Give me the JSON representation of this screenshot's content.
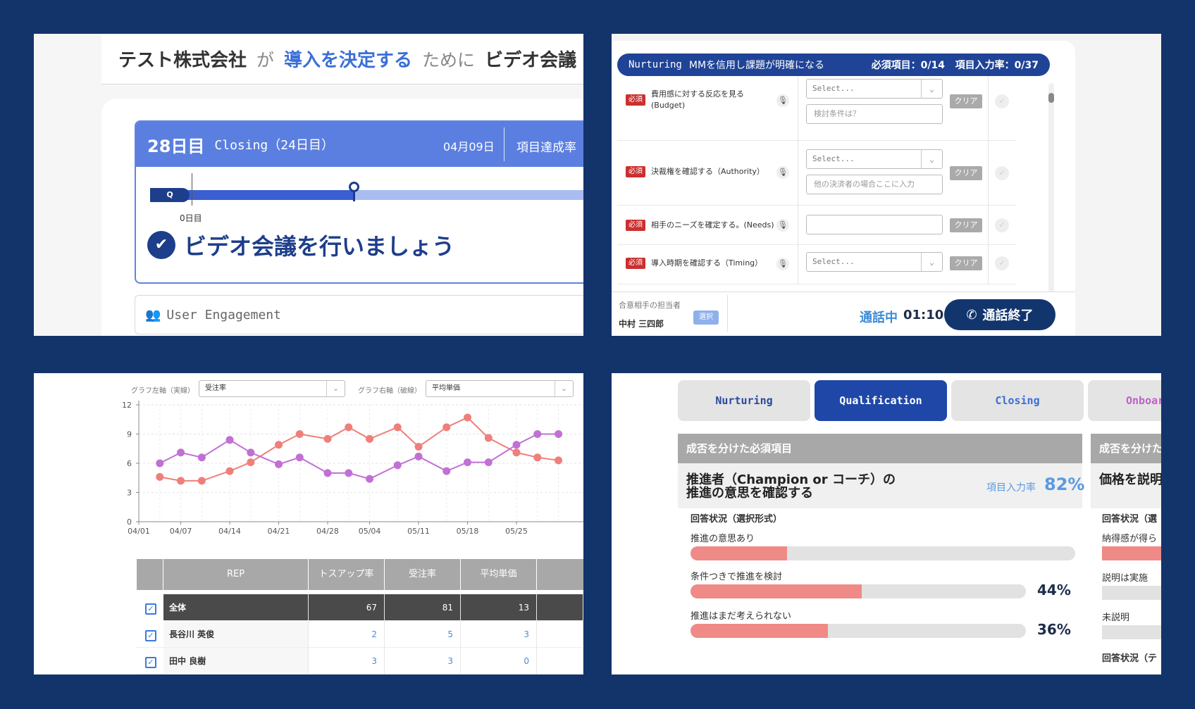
{
  "panel1": {
    "sentence": {
      "company": "テスト株式会社",
      "ga": "が",
      "goal": "導入を決定する",
      "tame": "ために",
      "action": "ビデオ会議"
    },
    "progress": {
      "day": "28日目",
      "phase": "Closing（24日目）",
      "date": "04月09日",
      "rate_label": "項目達成率",
      "stage_marker": "Q",
      "zero_label": "0日目",
      "progress_fraction": 0.44
    },
    "message": "ビデオ会議を行いましょう",
    "engagement": "User Engagement",
    "icons": {
      "message": "check-person-icon",
      "engagement": "users-icon"
    }
  },
  "panel2": {
    "header": {
      "phase": "Nurturing",
      "title": "MMを信用し課題が明確になる",
      "required": "必須項目：0/14",
      "input_rate": "項目入力率：0/37"
    },
    "rows": [
      {
        "badge": "必須",
        "label": "費用感に対する反応を見る\n(Budget)",
        "select": "Select...",
        "input": "検討条件は？",
        "clear": "クリア"
      },
      {
        "badge": "必須",
        "label": "決裁権を確認する（Authority）",
        "select": "Select...",
        "input": "他の決済者の場合ここに入力",
        "clear": "クリア"
      },
      {
        "badge": "必須",
        "label": "相手のニーズを確定する。(Needs)",
        "select": "",
        "input": "",
        "clear": "クリア"
      },
      {
        "badge": "必須",
        "label": "導入時期を確認する（Timing）",
        "select": "Select...",
        "input": "",
        "clear": "クリア"
      }
    ],
    "footer": {
      "assignee_label": "合意相手の担当者",
      "assignee": "中村 三四郎",
      "select_button": "選択",
      "status": "通話中",
      "timer": "01:10",
      "end_button": "通話終了"
    }
  },
  "panel3": {
    "controls": {
      "left_label": "グラフ左軸（実線）",
      "left_value": "受注率",
      "right_label": "グラフ右軸（破線）",
      "right_value": "平均単価"
    },
    "chart_data": {
      "type": "line",
      "x": [
        "04/04",
        "04/07",
        "04/10",
        "04/14",
        "04/17",
        "04/21",
        "04/24",
        "04/28",
        "05/01",
        "05/04",
        "05/08",
        "05/11",
        "05/15",
        "05/18",
        "05/21",
        "05/25",
        "05/28",
        "05/31"
      ],
      "xticks": [
        "04/01",
        "04/07",
        "04/14",
        "04/21",
        "04/28",
        "05/04",
        "05/11",
        "05/18",
        "05/25"
      ],
      "ylim": [
        0,
        12
      ],
      "yticks": [
        0,
        3,
        6,
        9,
        12
      ],
      "series": [
        {
          "color": "#ef7f7a",
          "values": [
            4.6,
            4.2,
            4.2,
            5.2,
            6.1,
            7.9,
            9.0,
            8.5,
            9.7,
            8.5,
            9.7,
            7.7,
            9.7,
            10.7,
            8.6,
            7.1,
            6.6,
            6.3
          ]
        },
        {
          "color": "#c170d4",
          "values": [
            6.0,
            7.1,
            6.6,
            8.4,
            7.1,
            5.9,
            6.6,
            5.0,
            5.0,
            4.4,
            5.8,
            6.7,
            5.2,
            6.1,
            6.1,
            7.9,
            9.0,
            9.0
          ]
        }
      ],
      "grid": true
    },
    "table": {
      "headers": [
        "REP",
        "トスアップ率",
        "受注率",
        "平均単価"
      ],
      "rows": [
        {
          "name": "全体",
          "v1": "67",
          "v2": "81",
          "v3": "13"
        },
        {
          "name": "長谷川 英俊",
          "v1": "2",
          "v2": "5",
          "v3": "3"
        },
        {
          "name": "田中 良樹",
          "v1": "3",
          "v2": "3",
          "v3": "0"
        }
      ]
    }
  },
  "panel4": {
    "tabs": [
      {
        "label": "Nurturing"
      },
      {
        "label": "Qualification"
      },
      {
        "label": "Closing"
      },
      {
        "label": "Onboar"
      }
    ],
    "section": "成否を分けた必須項目",
    "section2": "成否を分けた",
    "question": "推進者（Champion or コーチ）の\n推進の意思を確認する",
    "question2": "価格を説明",
    "rate_label": "項目入力率",
    "rate": "82%",
    "answers_label": "回答状況（選択形式）",
    "answers_label2": "回答状況（選",
    "options": [
      {
        "label": "推進の意思あり",
        "value": 0.25,
        "pct": ""
      },
      {
        "label": "条件つきで推進を検討",
        "value": 0.51,
        "pct": "44%"
      },
      {
        "label": "推進はまだ考えられない",
        "value": 0.41,
        "pct": "36%"
      }
    ],
    "options2": [
      {
        "label": "納得感が得ら",
        "value": 1.0
      },
      {
        "label": "説明は実施",
        "value": 0.0
      },
      {
        "label": "未説明",
        "value": 0.0
      }
    ],
    "answers_label3": "回答状況（テ"
  },
  "colors": {
    "navy": "#13346a",
    "accent": "#3b6fd8",
    "bar": "#ef8a86",
    "required": "#cc2f2f"
  }
}
